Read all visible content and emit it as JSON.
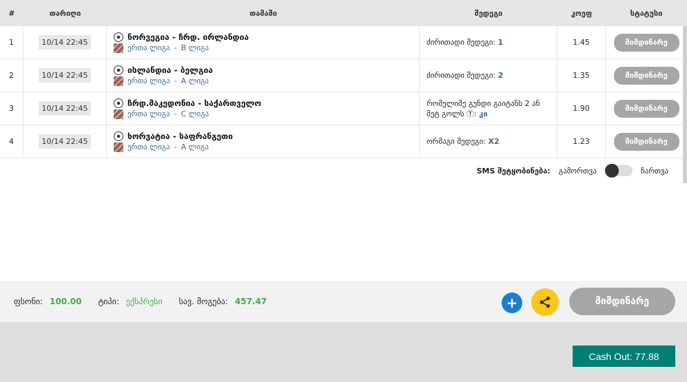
{
  "table": {
    "headers": {
      "num": "#",
      "date": "თარიღი",
      "game": "თამაში",
      "result": "შედეგი",
      "odd": "კოეფ",
      "status": "სტატუსი"
    },
    "rows": [
      {
        "num": "1",
        "date": "10/14 22:45",
        "teams": "ნორვეგია - ჩრდ. ირლანდია",
        "league_name": "ერთა ლიგა",
        "league_sep": " - ",
        "league_group": "B ლიგა",
        "result_label": "ძირითადი შედეგი:",
        "result_value": "1",
        "odd": "1.45",
        "status": "მიმდინარე"
      },
      {
        "num": "2",
        "date": "10/14 22:45",
        "teams": "ისლანდია - ბელგია",
        "league_name": "ერთა ლიგა",
        "league_sep": " - ",
        "league_group": "A ლიგა",
        "result_label": "ძირითადი შედეგი:",
        "result_value": "2",
        "odd": "1.35",
        "status": "მიმდინარე"
      },
      {
        "num": "3",
        "date": "10/14 22:45",
        "teams": "ჩრდ.მაკედონია - საქართველო",
        "league_name": "ერთა ლიგა",
        "league_sep": " - ",
        "league_group": "C ლიგა",
        "result_label": "რომელიმე გუნდი გაიტანს 2 ან მეტ გოლს Ⓣ:",
        "result_value": "კი",
        "odd": "1.90",
        "status": "მიმდინარე"
      },
      {
        "num": "4",
        "date": "10/14 22:45",
        "teams": "ხორვატია - საფრანგეთი",
        "league_name": "ერთა ლიგა",
        "league_sep": " - ",
        "league_group": "A ლიგა",
        "result_label": "ორმაგი შედეგი:",
        "result_value": "X2",
        "odd": "1.23",
        "status": "მიმდინარე"
      }
    ]
  },
  "sms": {
    "label": "SMS შეტყობინება:",
    "off_label": "გამორთვა",
    "on_label": "ჩართვა",
    "enabled": false
  },
  "footer": {
    "stake_label": "ფსონი:",
    "stake_value": "100.00",
    "type_label": "ტიპი:",
    "type_value": "ექსპრესი",
    "win_label": "სავ. მოგება:",
    "win_value": "457.47",
    "plus_symbol": "+",
    "status_button": "მიმდინარე"
  },
  "cashout": {
    "label": "Cash Out: 77.88"
  },
  "colors": {
    "accent_green": "#4ca64c",
    "cashout_bg": "#007f73",
    "share_bg": "#fcc61a",
    "plus_bg": "#1b7fd0",
    "status_gray": "#a6a6a6"
  }
}
